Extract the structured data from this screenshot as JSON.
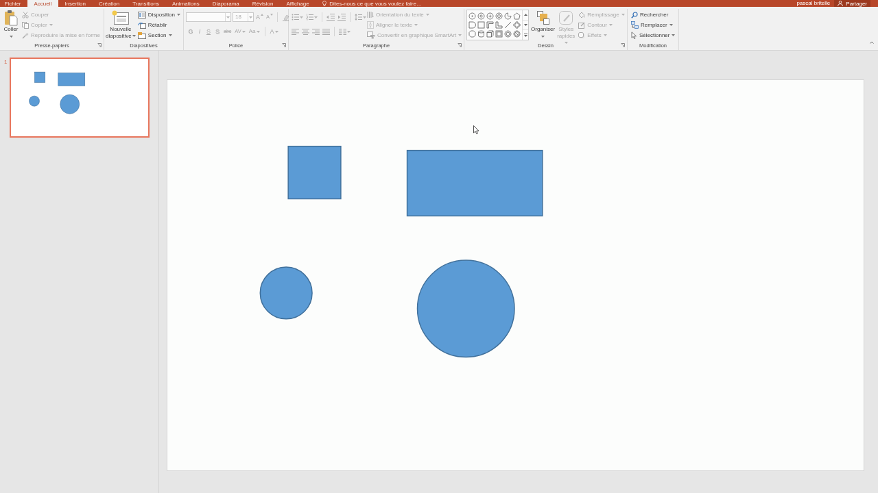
{
  "tabs": [
    {
      "label": "Fichier",
      "selected": false
    },
    {
      "label": "Accueil",
      "selected": true
    },
    {
      "label": "Insertion",
      "selected": false
    },
    {
      "label": "Création",
      "selected": false
    },
    {
      "label": "Transitions",
      "selected": false
    },
    {
      "label": "Animations",
      "selected": false
    },
    {
      "label": "Diaporama",
      "selected": false
    },
    {
      "label": "Révision",
      "selected": false
    },
    {
      "label": "Affichage",
      "selected": false
    }
  ],
  "tell_me": {
    "placeholder": "Dites-nous ce que vous voulez faire…"
  },
  "account": {
    "user": "pascal britelle",
    "share": "Partager"
  },
  "ribbon": {
    "clipboard": {
      "label": "Presse-papiers",
      "items": [
        {
          "label": "Coller",
          "disabled": false,
          "dropdown": true
        },
        {
          "label": "Couper",
          "disabled": true,
          "dropdown": false
        },
        {
          "label": "Copier",
          "disabled": true,
          "dropdown": true
        },
        {
          "label": "Reproduire la mise en forme",
          "disabled": true,
          "dropdown": false
        }
      ]
    },
    "slides": {
      "label": "Diapositives",
      "items": [
        {
          "label": "Nouvelle diapositive",
          "disabled": false,
          "dropdown": true
        },
        {
          "label": "Disposition",
          "disabled": false,
          "dropdown": true
        },
        {
          "label": "Rétablir",
          "disabled": false,
          "dropdown": false
        },
        {
          "label": "Section",
          "disabled": false,
          "dropdown": true
        }
      ]
    },
    "font": {
      "label": "Police",
      "disabled": true,
      "size_field": {
        "value": "18"
      },
      "size_buttons": [
        "A",
        "A"
      ],
      "format_buttons": [
        {
          "text": "G",
          "dropdown": false
        },
        {
          "text": "I",
          "dropdown": false
        },
        {
          "text": "S",
          "dropdown": false
        },
        {
          "text": "S",
          "dropdown": false
        },
        {
          "text": "abc",
          "dropdown": false
        },
        {
          "text": "AV",
          "dropdown": true
        },
        {
          "text": "Aa",
          "dropdown": true
        },
        {
          "text": "A",
          "dropdown": true
        }
      ]
    },
    "paragraph": {
      "label": "Paragraphe",
      "disabled": true,
      "commands": [
        {
          "label": "Orientation du texte",
          "dropdown": true
        },
        {
          "label": "Aligner le texte",
          "dropdown": true
        },
        {
          "label": "Convertir en graphique SmartArt",
          "dropdown": true
        }
      ]
    },
    "drawing": {
      "label": "Dessin",
      "items": [
        {
          "label": "Organiser",
          "disabled": false,
          "dropdown": true
        },
        {
          "label": "Styles rapides",
          "disabled": true,
          "dropdown": true
        },
        {
          "label": "Remplissage",
          "disabled": true,
          "dropdown": true
        },
        {
          "label": "Contour",
          "disabled": true,
          "dropdown": true
        },
        {
          "label": "Effets",
          "disabled": true,
          "dropdown": true
        }
      ]
    },
    "editing": {
      "label": "Modification",
      "items": [
        {
          "label": "Rechercher",
          "disabled": false,
          "dropdown": false
        },
        {
          "label": "Remplacer",
          "disabled": false,
          "dropdown": true
        },
        {
          "label": "Sélectionner",
          "disabled": false,
          "dropdown": true
        }
      ]
    }
  },
  "slides_panel": {
    "slides": [
      {
        "number": "1",
        "selected": true
      }
    ]
  },
  "slide": {
    "shapes": [
      {
        "kind": "rectangle"
      },
      {
        "kind": "rectangle"
      },
      {
        "kind": "ellipse"
      },
      {
        "kind": "ellipse"
      }
    ]
  }
}
